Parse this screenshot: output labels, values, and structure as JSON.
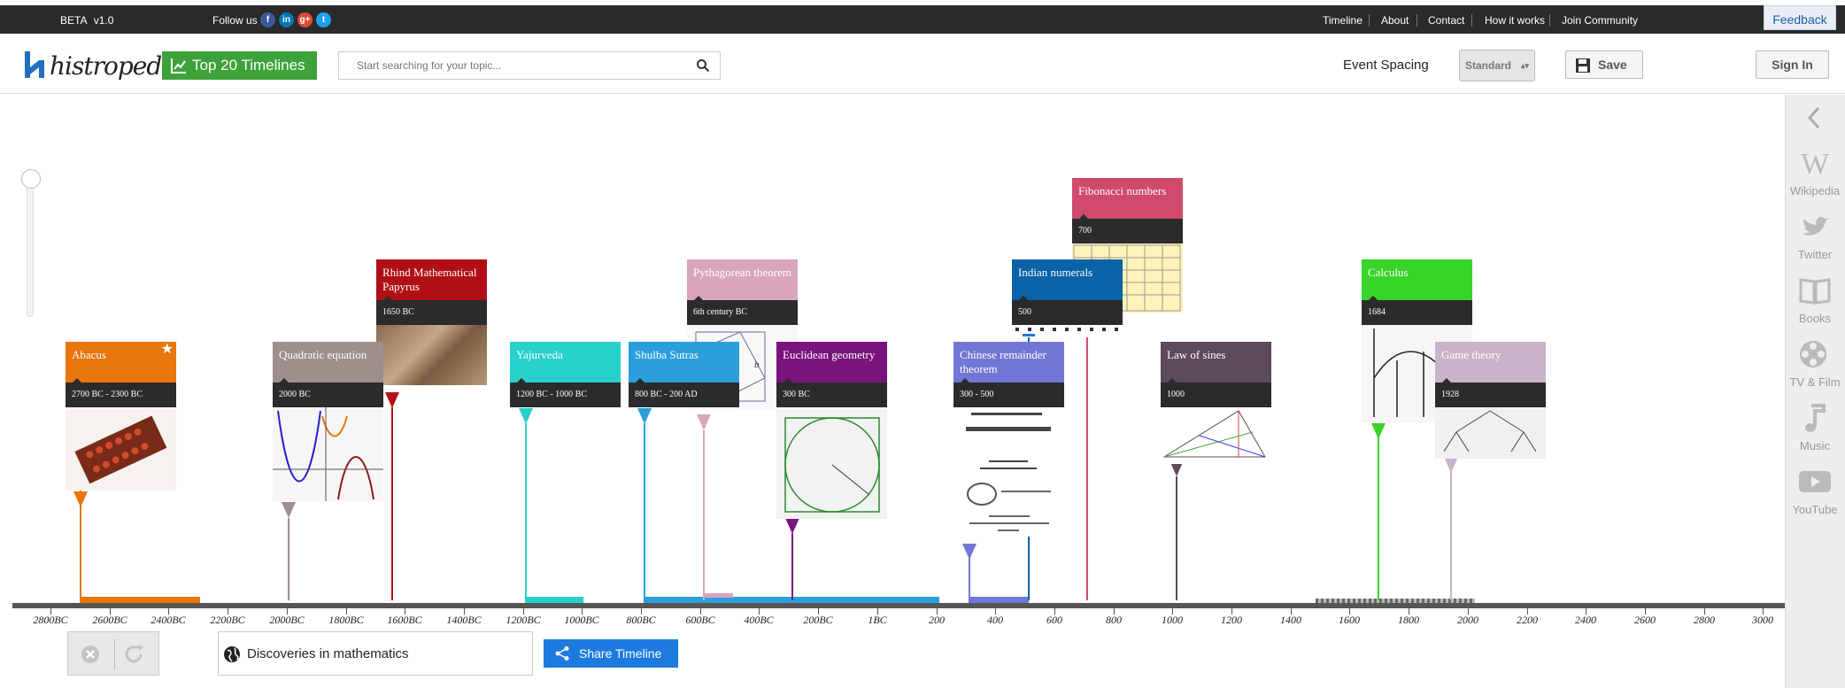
{
  "topbar": {
    "beta": "BETA",
    "version": "v1.0",
    "follow": "Follow us",
    "social": [
      "f",
      "in",
      "g+",
      "t"
    ],
    "links": [
      "Timeline",
      "About",
      "Contact",
      "How it works",
      "Join Community"
    ],
    "feedback": "Feedback"
  },
  "header": {
    "logo": "histropedia",
    "top20": "Top 20 Timelines",
    "search_placeholder": "Start searching for your topic...",
    "spacing_label": "Event Spacing",
    "spacing_value": "Standard",
    "save": "Save",
    "signin": "Sign In"
  },
  "sidebar": {
    "items": [
      "Wikipedia",
      "Twitter",
      "Books",
      "TV & Film",
      "Music",
      "YouTube"
    ]
  },
  "events": [
    {
      "title": "Abacus",
      "date": "2700 BC - 2300 BC",
      "color": "#e8760c"
    },
    {
      "title": "Quadratic equation",
      "date": "2000 BC",
      "color": "#9e8f8c"
    },
    {
      "title": "Rhind Mathematical Papyrus",
      "date": "1650 BC",
      "color": "#b01015"
    },
    {
      "title": "Yajurveda",
      "date": "1200 BC - 1000 BC",
      "color": "#28d0cc"
    },
    {
      "title": "Shulba Sutras",
      "date": "800 BC - 200 AD",
      "color": "#2a9fdc"
    },
    {
      "title": "Pythagorean theorem",
      "date": "6th century BC",
      "color": "#d9a5bd"
    },
    {
      "title": "Euclidean geometry",
      "date": "300 BC",
      "color": "#7a137d"
    },
    {
      "title": "Chinese remainder theorem",
      "date": "300 - 500",
      "color": "#7277d6"
    },
    {
      "title": "Indian numerals",
      "date": "500",
      "color": "#0a62a8"
    },
    {
      "title": "Fibonacci numbers",
      "date": "700",
      "color": "#d04a6c"
    },
    {
      "title": "Law of sines",
      "date": "1000",
      "color": "#5d4a5a"
    },
    {
      "title": "Calculus",
      "date": "1684",
      "color": "#38d42a"
    },
    {
      "title": "Game theory",
      "date": "1928",
      "color": "#c9b3c8"
    }
  ],
  "axis": {
    "labels": [
      "2800BC",
      "2600BC",
      "2400BC",
      "2200BC",
      "2000BC",
      "1800BC",
      "1600BC",
      "1400BC",
      "1200BC",
      "1000BC",
      "800BC",
      "600BC",
      "400BC",
      "200BC",
      "1BC",
      "200",
      "400",
      "600",
      "800",
      "1000",
      "1200",
      "1400",
      "1600",
      "1800",
      "2000",
      "2200",
      "2400",
      "2600",
      "2800",
      "3000"
    ]
  },
  "bottom": {
    "timeline_name": "Discoveries in mathematics",
    "share": "Share Timeline"
  },
  "colors": {
    "top20": "#3ea23a",
    "share": "#1d7be0",
    "logo": "#1f6fc1"
  }
}
